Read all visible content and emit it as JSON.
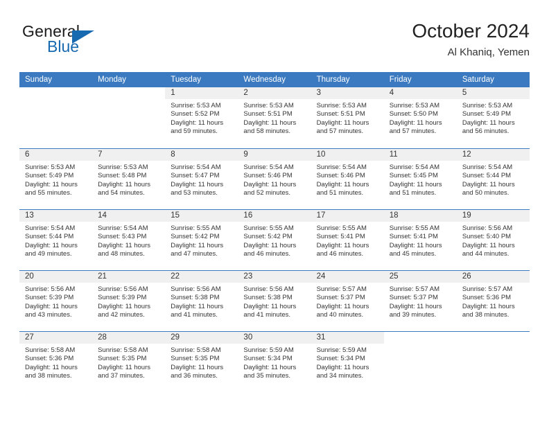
{
  "brand": {
    "name_top": "General",
    "name_bottom": "Blue",
    "color_primary": "#1769b0"
  },
  "header": {
    "title": "October 2024",
    "subtitle": "Al Khaniq, Yemen"
  },
  "theme": {
    "header_blue": "#3b7ac0",
    "daynum_band": "#f0f0f0",
    "text": "#333333"
  },
  "weekdays": [
    "Sunday",
    "Monday",
    "Tuesday",
    "Wednesday",
    "Thursday",
    "Friday",
    "Saturday"
  ],
  "labels": {
    "sunrise": "Sunrise:",
    "sunset": "Sunset:",
    "daylight": "Daylight:"
  },
  "weeks": [
    [
      {
        "day": "",
        "sunrise": "",
        "sunset": "",
        "daylight_1": "",
        "daylight_2": ""
      },
      {
        "day": "",
        "sunrise": "",
        "sunset": "",
        "daylight_1": "",
        "daylight_2": ""
      },
      {
        "day": "1",
        "sunrise": "Sunrise: 5:53 AM",
        "sunset": "Sunset: 5:52 PM",
        "daylight_1": "Daylight: 11 hours",
        "daylight_2": "and 59 minutes."
      },
      {
        "day": "2",
        "sunrise": "Sunrise: 5:53 AM",
        "sunset": "Sunset: 5:51 PM",
        "daylight_1": "Daylight: 11 hours",
        "daylight_2": "and 58 minutes."
      },
      {
        "day": "3",
        "sunrise": "Sunrise: 5:53 AM",
        "sunset": "Sunset: 5:51 PM",
        "daylight_1": "Daylight: 11 hours",
        "daylight_2": "and 57 minutes."
      },
      {
        "day": "4",
        "sunrise": "Sunrise: 5:53 AM",
        "sunset": "Sunset: 5:50 PM",
        "daylight_1": "Daylight: 11 hours",
        "daylight_2": "and 57 minutes."
      },
      {
        "day": "5",
        "sunrise": "Sunrise: 5:53 AM",
        "sunset": "Sunset: 5:49 PM",
        "daylight_1": "Daylight: 11 hours",
        "daylight_2": "and 56 minutes."
      }
    ],
    [
      {
        "day": "6",
        "sunrise": "Sunrise: 5:53 AM",
        "sunset": "Sunset: 5:49 PM",
        "daylight_1": "Daylight: 11 hours",
        "daylight_2": "and 55 minutes."
      },
      {
        "day": "7",
        "sunrise": "Sunrise: 5:53 AM",
        "sunset": "Sunset: 5:48 PM",
        "daylight_1": "Daylight: 11 hours",
        "daylight_2": "and 54 minutes."
      },
      {
        "day": "8",
        "sunrise": "Sunrise: 5:54 AM",
        "sunset": "Sunset: 5:47 PM",
        "daylight_1": "Daylight: 11 hours",
        "daylight_2": "and 53 minutes."
      },
      {
        "day": "9",
        "sunrise": "Sunrise: 5:54 AM",
        "sunset": "Sunset: 5:46 PM",
        "daylight_1": "Daylight: 11 hours",
        "daylight_2": "and 52 minutes."
      },
      {
        "day": "10",
        "sunrise": "Sunrise: 5:54 AM",
        "sunset": "Sunset: 5:46 PM",
        "daylight_1": "Daylight: 11 hours",
        "daylight_2": "and 51 minutes."
      },
      {
        "day": "11",
        "sunrise": "Sunrise: 5:54 AM",
        "sunset": "Sunset: 5:45 PM",
        "daylight_1": "Daylight: 11 hours",
        "daylight_2": "and 51 minutes."
      },
      {
        "day": "12",
        "sunrise": "Sunrise: 5:54 AM",
        "sunset": "Sunset: 5:44 PM",
        "daylight_1": "Daylight: 11 hours",
        "daylight_2": "and 50 minutes."
      }
    ],
    [
      {
        "day": "13",
        "sunrise": "Sunrise: 5:54 AM",
        "sunset": "Sunset: 5:44 PM",
        "daylight_1": "Daylight: 11 hours",
        "daylight_2": "and 49 minutes."
      },
      {
        "day": "14",
        "sunrise": "Sunrise: 5:54 AM",
        "sunset": "Sunset: 5:43 PM",
        "daylight_1": "Daylight: 11 hours",
        "daylight_2": "and 48 minutes."
      },
      {
        "day": "15",
        "sunrise": "Sunrise: 5:55 AM",
        "sunset": "Sunset: 5:42 PM",
        "daylight_1": "Daylight: 11 hours",
        "daylight_2": "and 47 minutes."
      },
      {
        "day": "16",
        "sunrise": "Sunrise: 5:55 AM",
        "sunset": "Sunset: 5:42 PM",
        "daylight_1": "Daylight: 11 hours",
        "daylight_2": "and 46 minutes."
      },
      {
        "day": "17",
        "sunrise": "Sunrise: 5:55 AM",
        "sunset": "Sunset: 5:41 PM",
        "daylight_1": "Daylight: 11 hours",
        "daylight_2": "and 46 minutes."
      },
      {
        "day": "18",
        "sunrise": "Sunrise: 5:55 AM",
        "sunset": "Sunset: 5:41 PM",
        "daylight_1": "Daylight: 11 hours",
        "daylight_2": "and 45 minutes."
      },
      {
        "day": "19",
        "sunrise": "Sunrise: 5:56 AM",
        "sunset": "Sunset: 5:40 PM",
        "daylight_1": "Daylight: 11 hours",
        "daylight_2": "and 44 minutes."
      }
    ],
    [
      {
        "day": "20",
        "sunrise": "Sunrise: 5:56 AM",
        "sunset": "Sunset: 5:39 PM",
        "daylight_1": "Daylight: 11 hours",
        "daylight_2": "and 43 minutes."
      },
      {
        "day": "21",
        "sunrise": "Sunrise: 5:56 AM",
        "sunset": "Sunset: 5:39 PM",
        "daylight_1": "Daylight: 11 hours",
        "daylight_2": "and 42 minutes."
      },
      {
        "day": "22",
        "sunrise": "Sunrise: 5:56 AM",
        "sunset": "Sunset: 5:38 PM",
        "daylight_1": "Daylight: 11 hours",
        "daylight_2": "and 41 minutes."
      },
      {
        "day": "23",
        "sunrise": "Sunrise: 5:56 AM",
        "sunset": "Sunset: 5:38 PM",
        "daylight_1": "Daylight: 11 hours",
        "daylight_2": "and 41 minutes."
      },
      {
        "day": "24",
        "sunrise": "Sunrise: 5:57 AM",
        "sunset": "Sunset: 5:37 PM",
        "daylight_1": "Daylight: 11 hours",
        "daylight_2": "and 40 minutes."
      },
      {
        "day": "25",
        "sunrise": "Sunrise: 5:57 AM",
        "sunset": "Sunset: 5:37 PM",
        "daylight_1": "Daylight: 11 hours",
        "daylight_2": "and 39 minutes."
      },
      {
        "day": "26",
        "sunrise": "Sunrise: 5:57 AM",
        "sunset": "Sunset: 5:36 PM",
        "daylight_1": "Daylight: 11 hours",
        "daylight_2": "and 38 minutes."
      }
    ],
    [
      {
        "day": "27",
        "sunrise": "Sunrise: 5:58 AM",
        "sunset": "Sunset: 5:36 PM",
        "daylight_1": "Daylight: 11 hours",
        "daylight_2": "and 38 minutes."
      },
      {
        "day": "28",
        "sunrise": "Sunrise: 5:58 AM",
        "sunset": "Sunset: 5:35 PM",
        "daylight_1": "Daylight: 11 hours",
        "daylight_2": "and 37 minutes."
      },
      {
        "day": "29",
        "sunrise": "Sunrise: 5:58 AM",
        "sunset": "Sunset: 5:35 PM",
        "daylight_1": "Daylight: 11 hours",
        "daylight_2": "and 36 minutes."
      },
      {
        "day": "30",
        "sunrise": "Sunrise: 5:59 AM",
        "sunset": "Sunset: 5:34 PM",
        "daylight_1": "Daylight: 11 hours",
        "daylight_2": "and 35 minutes."
      },
      {
        "day": "31",
        "sunrise": "Sunrise: 5:59 AM",
        "sunset": "Sunset: 5:34 PM",
        "daylight_1": "Daylight: 11 hours",
        "daylight_2": "and 34 minutes."
      },
      {
        "day": "",
        "sunrise": "",
        "sunset": "",
        "daylight_1": "",
        "daylight_2": ""
      },
      {
        "day": "",
        "sunrise": "",
        "sunset": "",
        "daylight_1": "",
        "daylight_2": ""
      }
    ]
  ]
}
